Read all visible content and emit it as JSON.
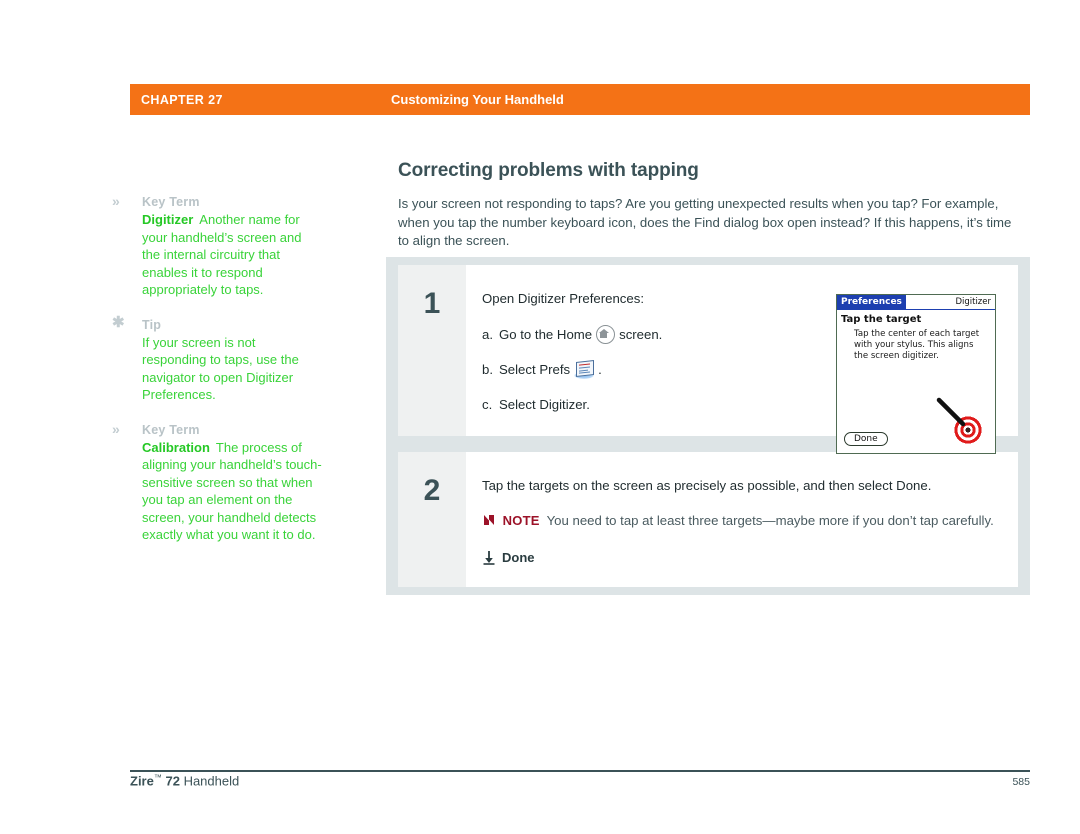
{
  "header": {
    "chapter": "CHAPTER 27",
    "title": "Customizing Your Handheld",
    "bar_color": "#f47216"
  },
  "sidebar": {
    "blocks": [
      {
        "icon": "chevron-double-right-icon",
        "icon_glyph": "»",
        "label": "Key Term",
        "term": "Digitizer",
        "body": "Another name for your handheld’s screen and the internal circuitry that enables it to respond appropriately to taps."
      },
      {
        "icon": "asterisk-icon",
        "icon_glyph": "✱",
        "label": "Tip",
        "term": "",
        "body": "If your screen is not responding to taps, use the navigator to open Digitizer Preferences."
      },
      {
        "icon": "chevron-double-right-icon",
        "icon_glyph": "»",
        "label": "Key Term",
        "term": "Calibration",
        "body": "The process of aligning your handheld’s touch-sensitive screen so that when you tap an element on the screen, your handheld detects exactly what you want it to do."
      }
    ],
    "label_color": "#b9c3c7",
    "body_color": "#39d339"
  },
  "main": {
    "heading": "Correcting problems with tapping",
    "intro": "Is your screen not responding to taps? Are you getting unexpected results when you tap? For example, when you tap the number keyboard icon, does the Find dialog box open instead? If this happens, it’s time to align the screen.",
    "heading_color": "#3b5257"
  },
  "steps": [
    {
      "number": "1",
      "intro": "Open Digitizer Preferences:",
      "substeps": [
        {
          "letter": "a.",
          "text_before": "Go to the Home",
          "icon": "home-icon",
          "text_after": "screen."
        },
        {
          "letter": "b.",
          "text_before": "Select Prefs",
          "icon": "prefs-icon",
          "text_after": "."
        },
        {
          "letter": "c.",
          "text_before": "Select Digitizer.",
          "icon": "",
          "text_after": ""
        }
      ]
    },
    {
      "number": "2",
      "intro": "Tap the targets on the screen as precisely as possible, and then select Done.",
      "note_tag": "NOTE",
      "note_text": "You need to tap at least three targets—maybe more if you don’t tap carefully.",
      "note_color": "#9c1228",
      "done_label": "Done"
    }
  ],
  "pda_screenshot": {
    "tab_label": "Preferences",
    "mode_label": "Digitizer",
    "heading": "Tap the target",
    "body": "Tap the center of each target with your stylus.  This aligns the screen digitizer.",
    "button_label": "Done",
    "target_color": "#e01b1b",
    "titlebar_color": "#1d3fb0"
  },
  "footer": {
    "product_bold": "Zire",
    "product_tm": "™",
    "product_model": "72",
    "product_suffix": "Handheld",
    "page_number": "585"
  }
}
